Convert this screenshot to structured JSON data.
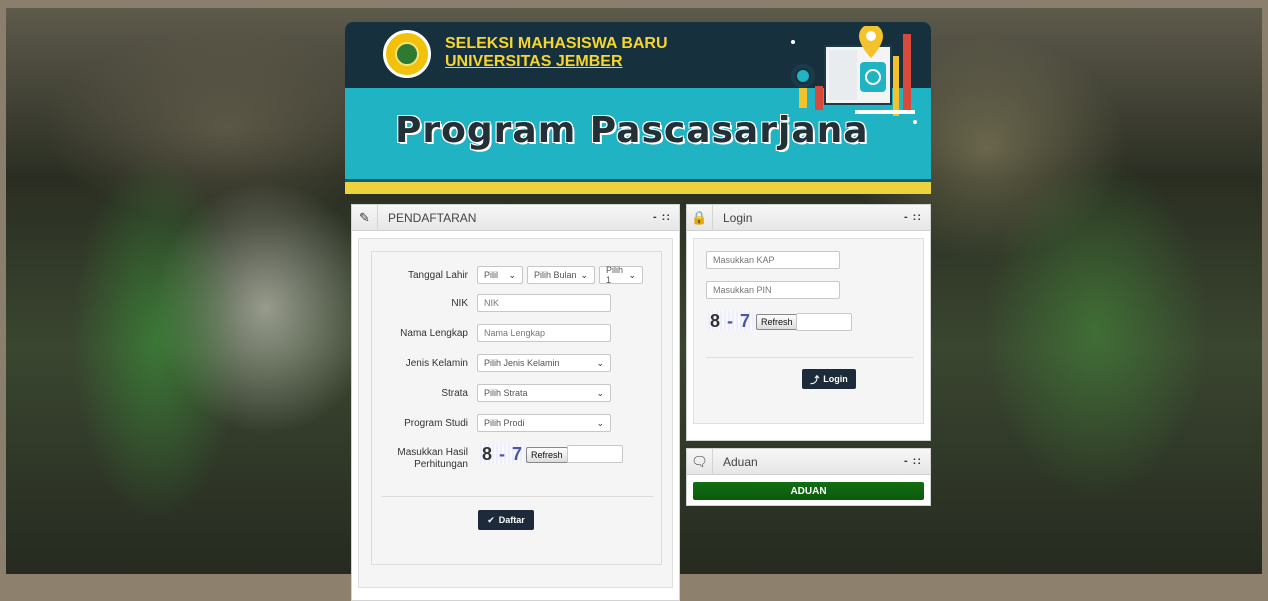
{
  "banner": {
    "title_line1": "SELEKSI MAHASISWA BARU",
    "title_line2": "UNIVERSITAS JEMBER",
    "program": "Program Pascasarjana"
  },
  "pendaftaran": {
    "title": "PENDAFTARAN",
    "controls": "- ::",
    "fields": {
      "tanggal_lahir_label": "Tanggal Lahir",
      "day_select": "Pilil",
      "month_select": "Pilih Bulan",
      "year_select": "Pilih 1",
      "nik_label": "NIK",
      "nik_placeholder": "NIK",
      "nama_label": "Nama Lengkap",
      "nama_placeholder": "Nama Lengkap",
      "jenis_kelamin_label": "Jenis Kelamin",
      "jenis_kelamin_select": "Pilih Jenis Kelamin",
      "strata_label": "Strata",
      "strata_select": "Pilih Strata",
      "prodi_label": "Program Studi",
      "prodi_select": "Pilih Prodi",
      "captcha_label_1": "Masukkan Hasil",
      "captcha_label_2": "Perhitungan",
      "captcha_a": "8",
      "captcha_op": " - ",
      "captcha_b": "7",
      "refresh_label": "Refresh"
    },
    "submit_label": "Daftar"
  },
  "login": {
    "title": "Login",
    "controls": "- ::",
    "kap_placeholder": "Masukkan KAP",
    "pin_placeholder": "Masukkan PIN",
    "captcha_a": "8",
    "captcha_op": " - ",
    "captcha_b": "7",
    "refresh_label": "Refresh",
    "submit_label": "Login"
  },
  "aduan": {
    "title": "Aduan",
    "controls": "- ::",
    "button_label": "ADUAN"
  },
  "icons": {
    "pendaftaran": "edit-icon",
    "login": "lock-icon",
    "aduan": "comment-icon"
  }
}
